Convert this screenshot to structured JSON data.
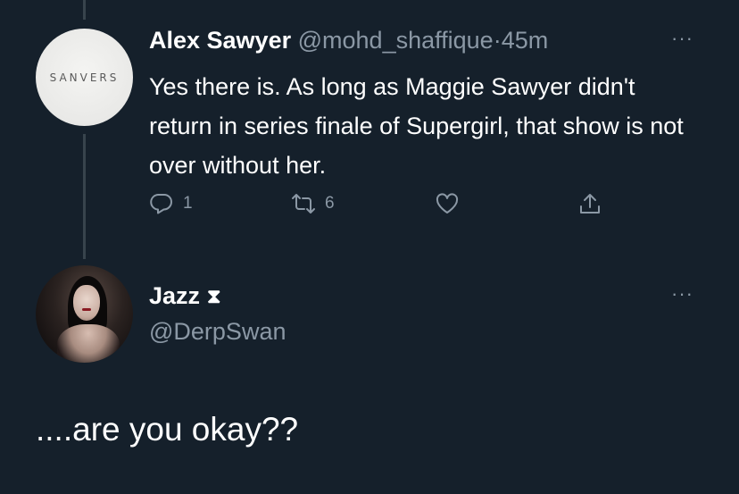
{
  "tweet1": {
    "avatar_text": "SANVERS",
    "name": "Alex Sawyer",
    "handle": "@mohd_shaffique",
    "separator": "·",
    "time": "45m",
    "more": "···",
    "text": "Yes there is. As long as Maggie Sawyer didn't return in series finale of Supergirl, that show is not over without her.",
    "actions": {
      "reply_icon": "reply-icon",
      "reply_count": "1",
      "retweet_icon": "retweet-icon",
      "retweet_count": "6",
      "like_icon": "heart-icon",
      "share_icon": "share-icon"
    }
  },
  "tweet2": {
    "name": "Jazz",
    "badge": "⧗",
    "handle": "@DerpSwan",
    "more": "···",
    "text": "....are you okay??"
  },
  "colors": {
    "background": "#15202b",
    "secondary_text": "#8b98a5",
    "primary_text": "#ffffff",
    "thread_line": "#38444d"
  }
}
